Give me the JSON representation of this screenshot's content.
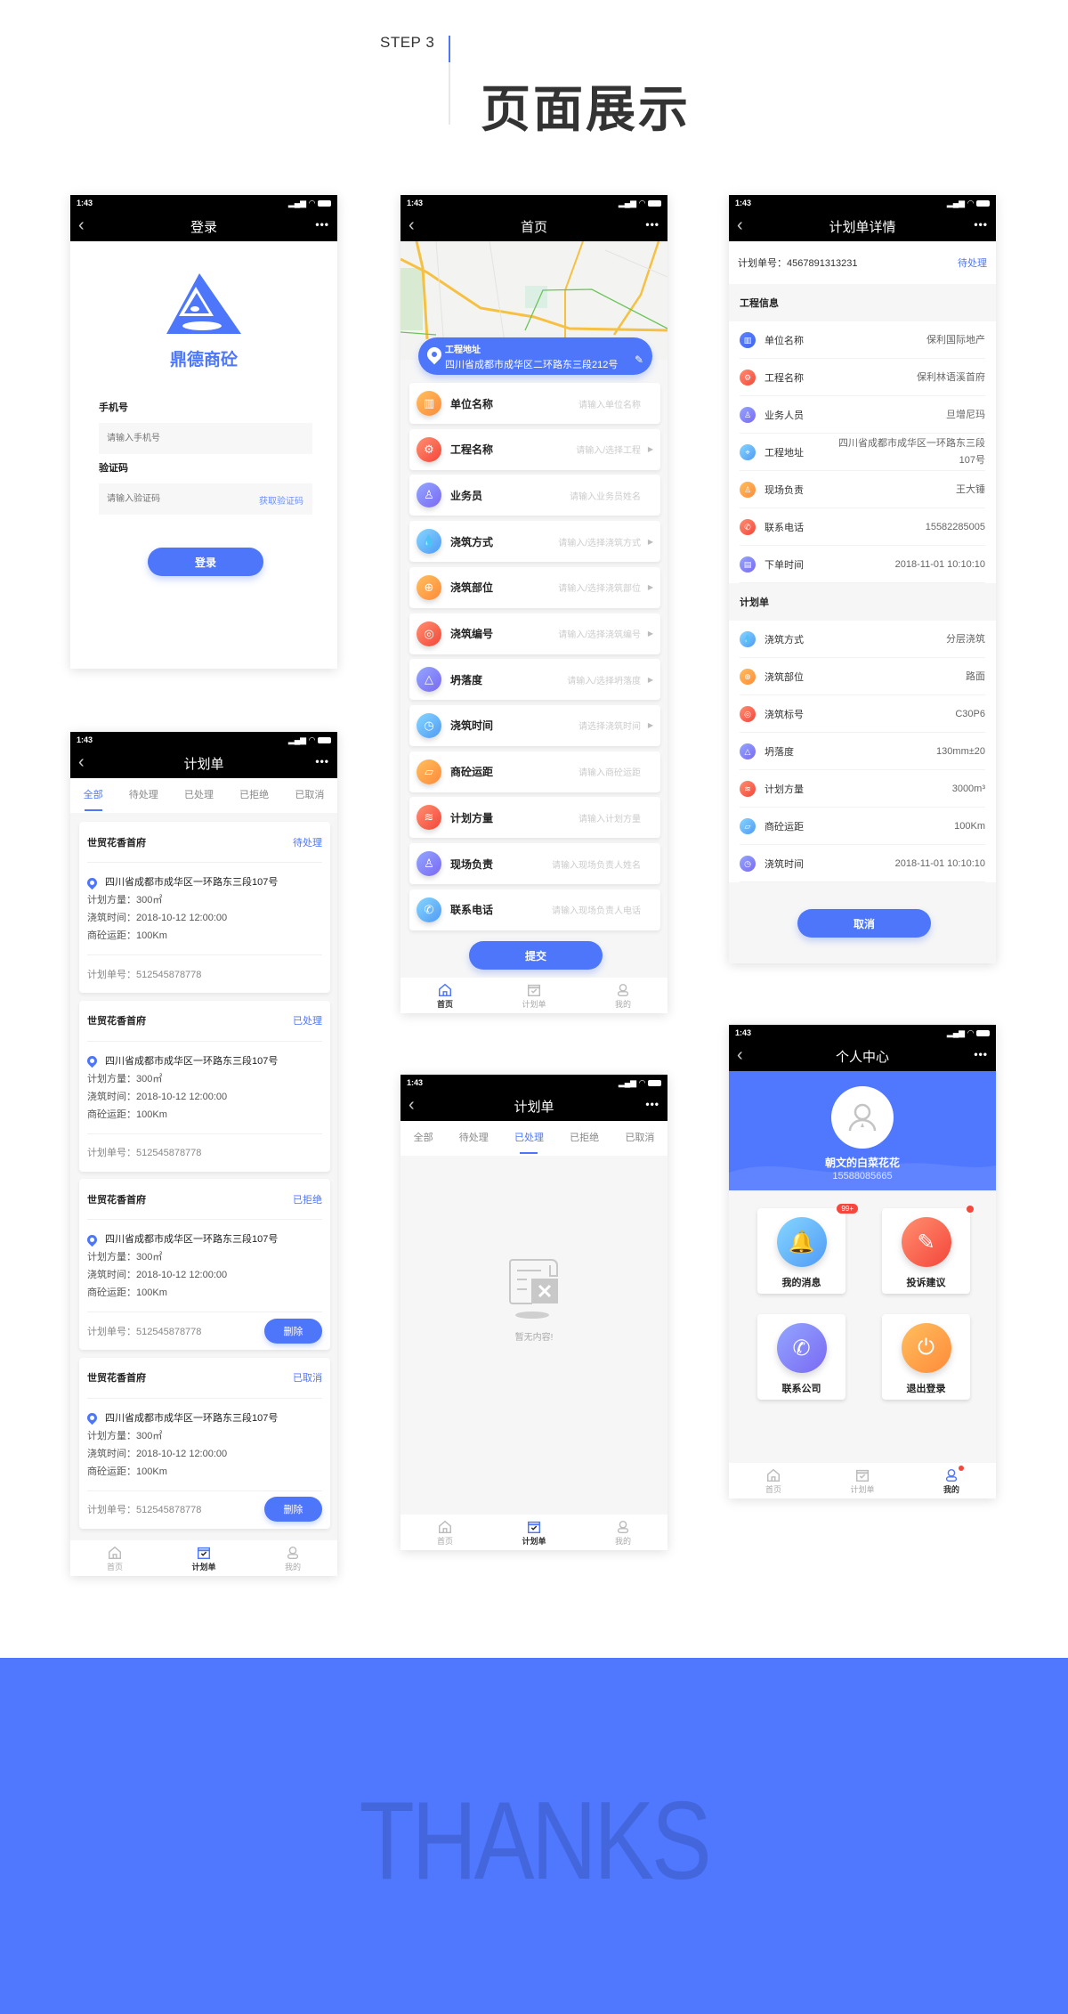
{
  "header": {
    "step": "STEP 3",
    "title": "页面展示"
  },
  "status_time": "1:43",
  "colors": {
    "primary": "#4d76fb",
    "footer_bg": "#5078ff",
    "footer_text": "#4466dd",
    "badge": "#f5473b"
  },
  "tabbar": [
    {
      "label": "首页",
      "icon": "home-icon"
    },
    {
      "label": "计划单",
      "icon": "calendar-check-icon"
    },
    {
      "label": "我的",
      "icon": "user-icon"
    }
  ],
  "login": {
    "title": "登录",
    "brand": "鼎德商砼",
    "phone_label": "手机号",
    "phone_placeholder": "请输入手机号",
    "code_label": "验证码",
    "code_placeholder": "请输入验证码",
    "get_code": "获取验证码",
    "submit": "登录"
  },
  "home": {
    "title": "首页",
    "address_label": "工程地址",
    "address": "四川省成都市成华区二环路东三段212号",
    "fields": [
      {
        "label": "单位名称",
        "placeholder": "请输入单位名称",
        "icon": "building-icon",
        "color": "orange",
        "arrow": false
      },
      {
        "label": "工程名称",
        "placeholder": "请输入/选择工程",
        "icon": "gear-icon",
        "color": "red",
        "arrow": true
      },
      {
        "label": "业务员",
        "placeholder": "请输入业务员姓名",
        "icon": "user-icon",
        "color": "purple",
        "arrow": false
      },
      {
        "label": "浇筑方式",
        "placeholder": "请输入/选择浇筑方式",
        "icon": "drop-icon",
        "color": "lblue",
        "arrow": true
      },
      {
        "label": "浇筑部位",
        "placeholder": "请输入/选择浇筑部位",
        "icon": "crosshair-icon",
        "color": "orange",
        "arrow": true
      },
      {
        "label": "浇筑编号",
        "placeholder": "请输入/选择浇筑编号",
        "icon": "target-icon",
        "color": "red",
        "arrow": true
      },
      {
        "label": "坍落度",
        "placeholder": "请输入/选择坍落度",
        "icon": "triangle-icon",
        "color": "purple",
        "arrow": true
      },
      {
        "label": "浇筑时间",
        "placeholder": "请选择浇筑时间",
        "icon": "clock-icon",
        "color": "lblue",
        "arrow": true
      },
      {
        "label": "商砼运距",
        "placeholder": "请输入商砼运距",
        "icon": "ruler-icon",
        "color": "orange",
        "arrow": false
      },
      {
        "label": "计划方量",
        "placeholder": "请输入计划方量",
        "icon": "layers-icon",
        "color": "red",
        "arrow": false
      },
      {
        "label": "现场负责",
        "placeholder": "请输入现场负责人姓名",
        "icon": "manager-icon",
        "color": "purple",
        "arrow": false
      },
      {
        "label": "联系电话",
        "placeholder": "请输入现场负责人电话",
        "icon": "phone-icon",
        "color": "lblue",
        "arrow": false
      }
    ],
    "submit": "提交"
  },
  "detail": {
    "title": "计划单详情",
    "plan_no_label": "计划单号：",
    "plan_no": "4567891313231",
    "status": "待处理",
    "section1": "工程信息",
    "rows1": [
      {
        "label": "单位名称",
        "value": "保利国际地产",
        "icon": "building-icon",
        "color": "blue"
      },
      {
        "label": "工程名称",
        "value": "保利林语溪首府",
        "icon": "gear-icon",
        "color": "red"
      },
      {
        "label": "业务人员",
        "value": "旦增尼玛",
        "icon": "user-icon",
        "color": "purple"
      },
      {
        "label": "工程地址",
        "value": "四川省成都市成华区一环路东三段107号",
        "icon": "location-icon",
        "color": "lblue"
      },
      {
        "label": "现场负责",
        "value": "王大锤",
        "icon": "manager-icon",
        "color": "orange"
      },
      {
        "label": "联系电话",
        "value": "15582285005",
        "icon": "phone-icon",
        "color": "red"
      },
      {
        "label": "下单时间",
        "value": "2018-11-01 10:10:10",
        "icon": "document-icon",
        "color": "purple"
      }
    ],
    "section2": "计划单",
    "rows2": [
      {
        "label": "浇筑方式",
        "value": "分层浇筑",
        "icon": "drop-icon",
        "color": "lblue"
      },
      {
        "label": "浇筑部位",
        "value": "路面",
        "icon": "crosshair-icon",
        "color": "orange"
      },
      {
        "label": "浇筑标号",
        "value": "C30P6",
        "icon": "target-icon",
        "color": "red"
      },
      {
        "label": "坍落度",
        "value": "130mm±20",
        "icon": "triangle-icon",
        "color": "purple"
      },
      {
        "label": "计划方量",
        "value": "3000m³",
        "icon": "layers-icon",
        "color": "red"
      },
      {
        "label": "商砼运距",
        "value": "100Km",
        "icon": "ruler-icon",
        "color": "lblue"
      },
      {
        "label": "浇筑时间",
        "value": "2018-11-01 10:10:10",
        "icon": "clock-icon",
        "color": "purple"
      }
    ],
    "cancel": "取消"
  },
  "list": {
    "title": "计划单",
    "tabs": [
      "全部",
      "待处理",
      "已处理",
      "已拒绝",
      "已取消"
    ],
    "active_tab": 0,
    "cards": [
      {
        "name": "世贸花香首府",
        "status": "待处理",
        "address": "四川省成都市成华区一环路东三段107号",
        "volume": "计划方量：300㎡",
        "time": "浇筑时间：2018-10-12  12:00:00",
        "distance": "商砼运距：100Km",
        "plan_no": "计划单号：512545878778"
      },
      {
        "name": "世贸花香首府",
        "status": "已处理",
        "address": "四川省成都市成华区一环路东三段107号",
        "volume": "计划方量：300㎡",
        "time": "浇筑时间：2018-10-12  12:00:00",
        "distance": "商砼运距：100Km",
        "plan_no": "计划单号：512545878778"
      },
      {
        "name": "世贸花香首府",
        "status": "已拒绝",
        "address": "四川省成都市成华区一环路东三段107号",
        "volume": "计划方量：300㎡",
        "time": "浇筑时间：2018-10-12  12:00:00",
        "distance": "商砼运距：100Km",
        "plan_no": "计划单号：512545878778",
        "delete": "删除"
      },
      {
        "name": "世贸花香首府",
        "status": "已取消",
        "address": "四川省成都市成华区一环路东三段107号",
        "volume": "计划方量：300㎡",
        "time": "浇筑时间：2018-10-12  12:00:00",
        "distance": "商砼运距：100Km",
        "plan_no": "计划单号：512545878778",
        "delete": "删除"
      }
    ]
  },
  "empty": {
    "title": "计划单",
    "tabs": [
      "全部",
      "待处理",
      "已处理",
      "已拒绝",
      "已取消"
    ],
    "active_tab": 2,
    "text": "暂无内容!"
  },
  "profile": {
    "title": "个人中心",
    "name": "朝文的白菜花花",
    "phone": "15588085665",
    "items": [
      {
        "label": "我的消息",
        "icon": "bell-icon",
        "color": "lblue",
        "badge": "99+"
      },
      {
        "label": "投诉建议",
        "icon": "edit-icon",
        "color": "red",
        "dot": true
      },
      {
        "label": "联系公司",
        "icon": "phone-icon",
        "color": "purple"
      },
      {
        "label": "退出登录",
        "icon": "power-icon",
        "color": "orange"
      }
    ]
  },
  "footer": {
    "thanks": "THANKS"
  }
}
